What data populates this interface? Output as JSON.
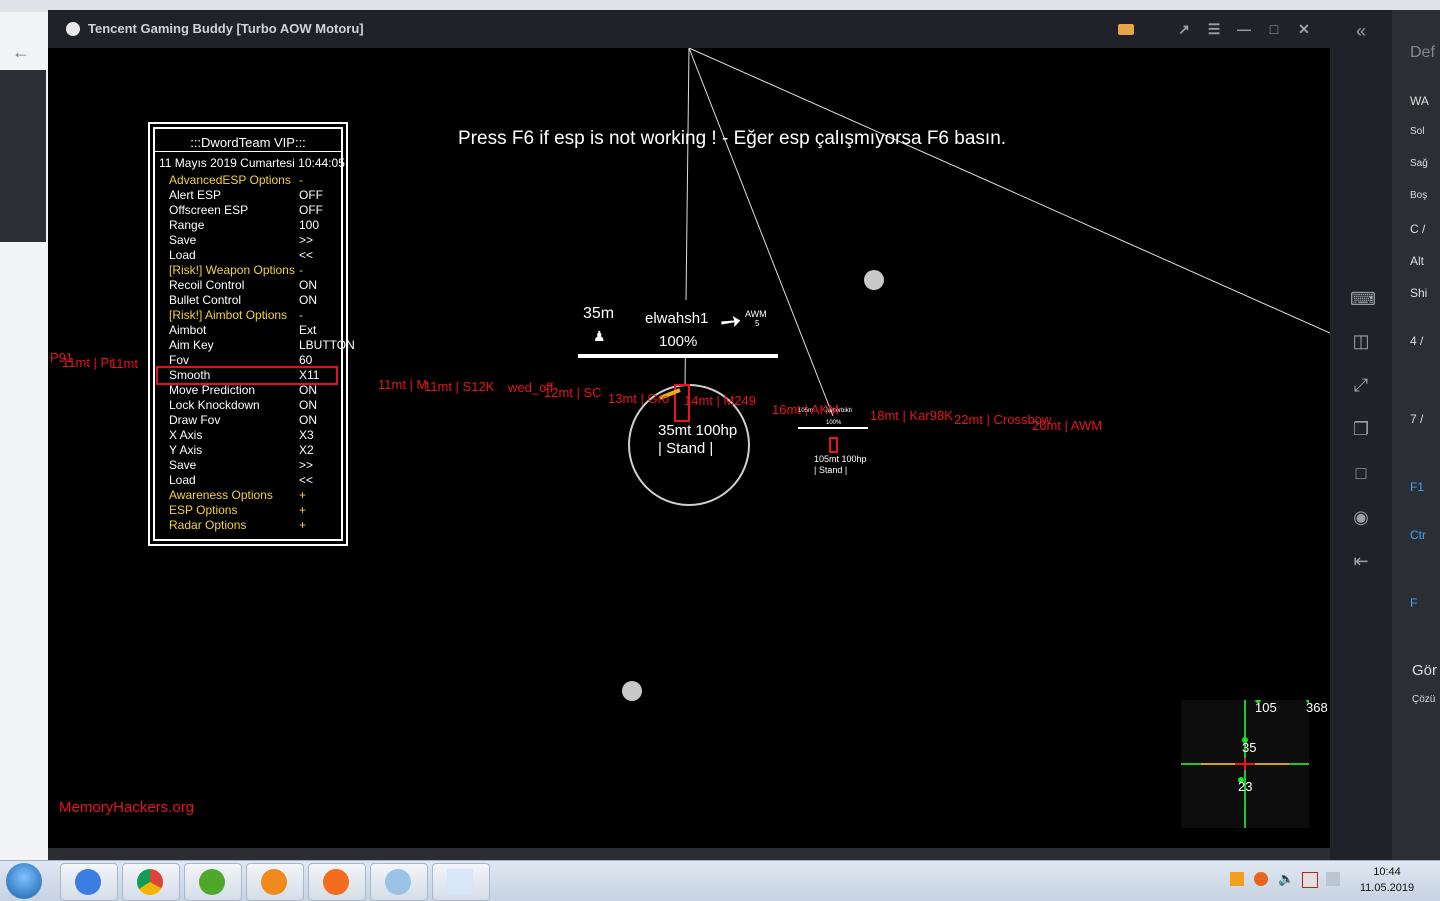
{
  "window": {
    "title": "Tencent Gaming Buddy [Turbo AOW Motoru]"
  },
  "game": {
    "notice": "Press F6 if esp is not working ! - Eğer esp çalışmıyorsa F6 basın.",
    "watermark": "MemoryHackers.org"
  },
  "menu": {
    "title": ":::DwordTeam VIP:::",
    "datetime": "11 Mayıs 2019 Cumartesi 10:44:05",
    "rows": [
      {
        "label": "AdvancedESP Options",
        "value": "-",
        "header": true
      },
      {
        "label": "Alert ESP",
        "value": "OFF"
      },
      {
        "label": "Offscreen ESP",
        "value": "OFF"
      },
      {
        "label": "Range",
        "value": "100"
      },
      {
        "label": "Save",
        "value": ">>"
      },
      {
        "label": "Load",
        "value": "<<"
      },
      {
        "label": "[Risk!] Weapon Options",
        "value": "-",
        "header": true
      },
      {
        "label": "Recoil Control",
        "value": "ON"
      },
      {
        "label": "Bullet Control",
        "value": "ON"
      },
      {
        "label": "[Risk!] Aimbot Options",
        "value": "-",
        "header": true
      },
      {
        "label": "Aimbot",
        "value": "Ext"
      },
      {
        "label": "Aim Key",
        "value": "LBUTTON"
      },
      {
        "label": "Fov",
        "value": "60"
      },
      {
        "label": "Smooth",
        "value": "X11",
        "selected": true
      },
      {
        "label": "Move Prediction",
        "value": "ON"
      },
      {
        "label": "Lock Knockdown",
        "value": "ON"
      },
      {
        "label": "Draw Fov",
        "value": "ON"
      },
      {
        "label": "X Axis",
        "value": "X3"
      },
      {
        "label": "Y Axis",
        "value": "X2"
      },
      {
        "label": "Save",
        "value": ">>"
      },
      {
        "label": "Load",
        "value": "<<"
      },
      {
        "label": "Awareness Options",
        "value": "+",
        "header": true
      },
      {
        "label": "ESP Options",
        "value": "+",
        "header": true
      },
      {
        "label": "Radar Options",
        "value": "+",
        "header": true
      }
    ]
  },
  "esp": {
    "distance": "35m",
    "player_name": "elwahsh1",
    "health": "100%",
    "weapon": "AWM",
    "weapon_ammo": "5",
    "target_info_line1": "35mt 100hp",
    "target_info_line2": "| Stand |",
    "far_info_line1": "105mt 100hp",
    "far_info_line2": "| Stand |",
    "far_box_distance": "105m",
    "far_box_name": "Jaiherbikh",
    "far_box_health": "100%",
    "items": [
      "P91",
      "11mt | Pi",
      "11mt",
      "11mt | M",
      "11mt | S12K",
      "wed_off",
      "12mt | SC",
      "13mt | Gro",
      "14mt | M249",
      "16mt | AKM",
      "18mt | Kar98K",
      "22mt | Crossbow",
      "26mt | AWM"
    ]
  },
  "radar": {
    "labels": [
      "105",
      "368",
      "35",
      "23"
    ]
  },
  "right_panel": {
    "items": [
      "Def",
      "WA",
      "Sol",
      "Sağ",
      "Boş",
      "C /",
      "Alt",
      "Shi",
      "4 /",
      "7 /",
      "F1",
      "Ctr",
      "F",
      "Gör",
      "Çözü"
    ]
  },
  "taskbar": {
    "time": "10:44",
    "date": "11.05.2019"
  }
}
